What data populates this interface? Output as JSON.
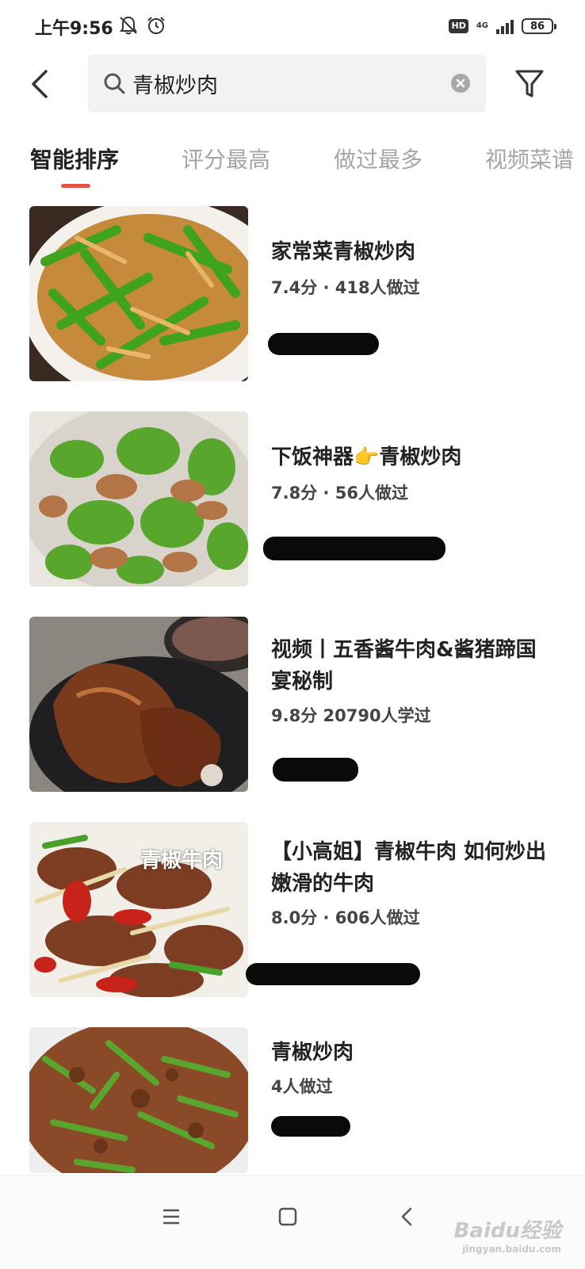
{
  "status_bar": {
    "time": "上午9:56",
    "hd": "HD",
    "network": "4G",
    "battery": "86",
    "icons": [
      "mute-bell-icon",
      "alarm-clock-icon",
      "signal-icon",
      "battery-icon"
    ]
  },
  "search": {
    "query": "青椒炒肉",
    "icons": [
      "back-arrow-icon",
      "search-icon",
      "clear-icon",
      "filter-funnel-icon"
    ]
  },
  "tabs": [
    {
      "label": "智能排序",
      "active": true
    },
    {
      "label": "评分最高",
      "active": false
    },
    {
      "label": "做过最多",
      "active": false
    },
    {
      "label": "视频菜谱",
      "active": false
    }
  ],
  "recipes": [
    {
      "title": "家常菜青椒炒肉",
      "meta": "7.4分 · 418人做过"
    },
    {
      "title": "下饭神器👉青椒炒肉",
      "meta": "7.8分 · 56人做过"
    },
    {
      "title": "视频丨五香酱牛肉&酱猪蹄国宴秘制",
      "meta": "9.8分 20790人学过"
    },
    {
      "title": "【小高姐】青椒牛肉 如何炒出嫩滑的牛肉",
      "meta": "8.0分 · 606人做过",
      "thumb_caption": "青椒牛肉"
    },
    {
      "title": "青椒炒肉",
      "meta": "4人做过"
    }
  ],
  "nav_bar": {
    "icons": [
      "menu-icon",
      "home-square-icon",
      "back-icon"
    ]
  },
  "watermark": {
    "brand": "Baidu经验",
    "url": "jingyan.baidu.com"
  },
  "colors": {
    "accent": "#e5534b",
    "tab_inactive": "#a5a5a5",
    "search_bg": "#f2f2f2"
  }
}
